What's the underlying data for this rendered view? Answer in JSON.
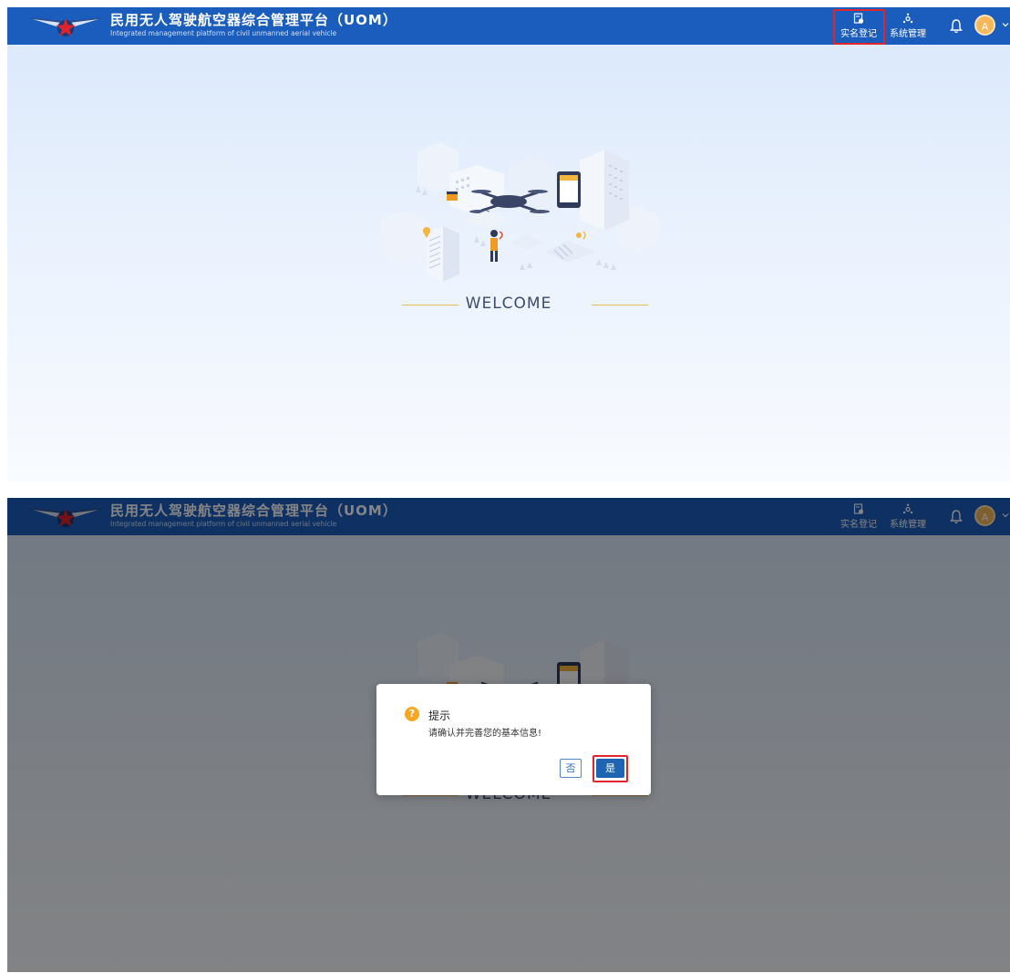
{
  "header": {
    "title_cn": "民用无人驾驶航空器综合管理平台（UOM）",
    "title_en": "Integrated management platform of civil unmanned aerial vehicle",
    "nav": {
      "realname_label": "实名登记",
      "realname_icon": "document-id-icon",
      "system_label": "系统管理",
      "system_icon": "network-settings-icon"
    },
    "bell_icon": "bell-icon",
    "avatar_letter": "A",
    "chevron_icon": "chevron-down-icon"
  },
  "main": {
    "welcome_text": "WELCOME",
    "illustration": "drone-city-illustration"
  },
  "dialog": {
    "icon": "question-circle-icon",
    "title": "提示",
    "message": "请确认并完善您的基本信息!",
    "no_label": "否",
    "yes_label": "是"
  },
  "colors": {
    "header_bg": "#1b5dbd",
    "accent": "#1f63b3",
    "highlight": "#e0252b",
    "avatar_bg": "#f6b65a",
    "warning": "#f6a623"
  }
}
